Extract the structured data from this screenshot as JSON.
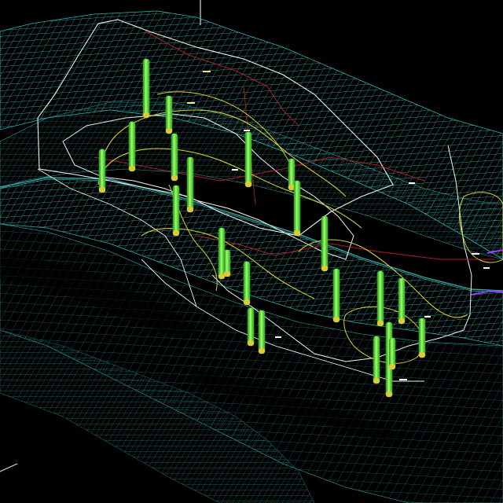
{
  "viewer": {
    "view": "3d-perspective",
    "background_color": "#000000"
  },
  "colors": {
    "block_mesh": "#2fb3b0",
    "block_mesh_dark": "#1a6f70",
    "block_mesh_fill": "#0c3436",
    "axis": "#d9d9d9",
    "boundary": "#f2f2f2",
    "contour": "#d8d02e",
    "fault": "#b01e1e",
    "drillhole": "#3fd12a",
    "drillhole_light": "#9cff6a",
    "drillhole_intercept": "#e0c83a",
    "survey_marker": "#ffffff",
    "alt_marker": "#9a3cff"
  },
  "layers": [
    {
      "name": "block-model-mesh",
      "visible": true
    },
    {
      "name": "drillholes",
      "visible": true
    },
    {
      "name": "contours",
      "visible": true
    },
    {
      "name": "boundaries",
      "visible": true
    },
    {
      "name": "faults",
      "visible": true
    }
  ]
}
